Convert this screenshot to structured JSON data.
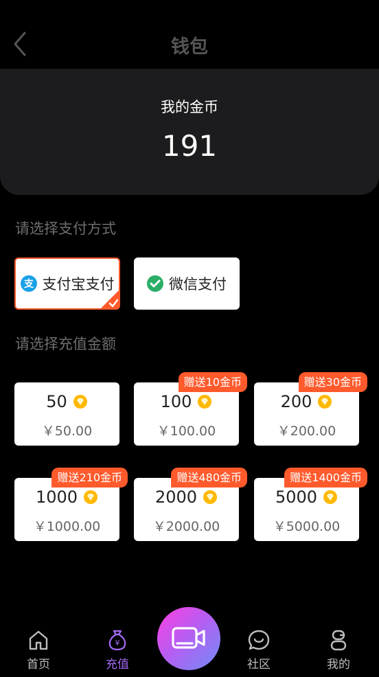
{
  "header": {
    "title": "钱包",
    "back_icon": "chevron-left-icon"
  },
  "wallet": {
    "label": "我的金币",
    "value": "191"
  },
  "payment": {
    "label": "请选择支付方式",
    "methods": [
      {
        "label": "支付宝支付",
        "icon": "alipay-icon",
        "selected": true,
        "color": "#1aa0e8"
      },
      {
        "label": "微信支付",
        "icon": "wechat-pay-icon",
        "selected": false,
        "color": "#2aae67"
      }
    ]
  },
  "recharge": {
    "label": "请选择充值金额",
    "options": [
      {
        "coins": "50",
        "price": "￥50.00",
        "bonus": ""
      },
      {
        "coins": "100",
        "price": "￥100.00",
        "bonus": "赠送10金币"
      },
      {
        "coins": "200",
        "price": "￥200.00",
        "bonus": "赠送30金币"
      },
      {
        "coins": "1000",
        "price": "￥1000.00",
        "bonus": "赠送210金币"
      },
      {
        "coins": "2000",
        "price": "￥2000.00",
        "bonus": "赠送480金币"
      },
      {
        "coins": "5000",
        "price": "￥5000.00",
        "bonus": "赠送1400金币"
      }
    ]
  },
  "tabbar": {
    "items": [
      {
        "label": "首页",
        "icon": "home-icon",
        "active": false
      },
      {
        "label": "充值",
        "icon": "money-bag-icon",
        "active": true
      },
      {
        "label": "社区",
        "icon": "chat-bubble-icon",
        "active": false
      },
      {
        "label": "我的",
        "icon": "profile-icon",
        "active": false
      }
    ],
    "center_icon": "video-camera-icon"
  },
  "colors": {
    "accent": "#ff5a2c",
    "active_tab": "#a46bf5",
    "diamond": "#ffb800"
  }
}
